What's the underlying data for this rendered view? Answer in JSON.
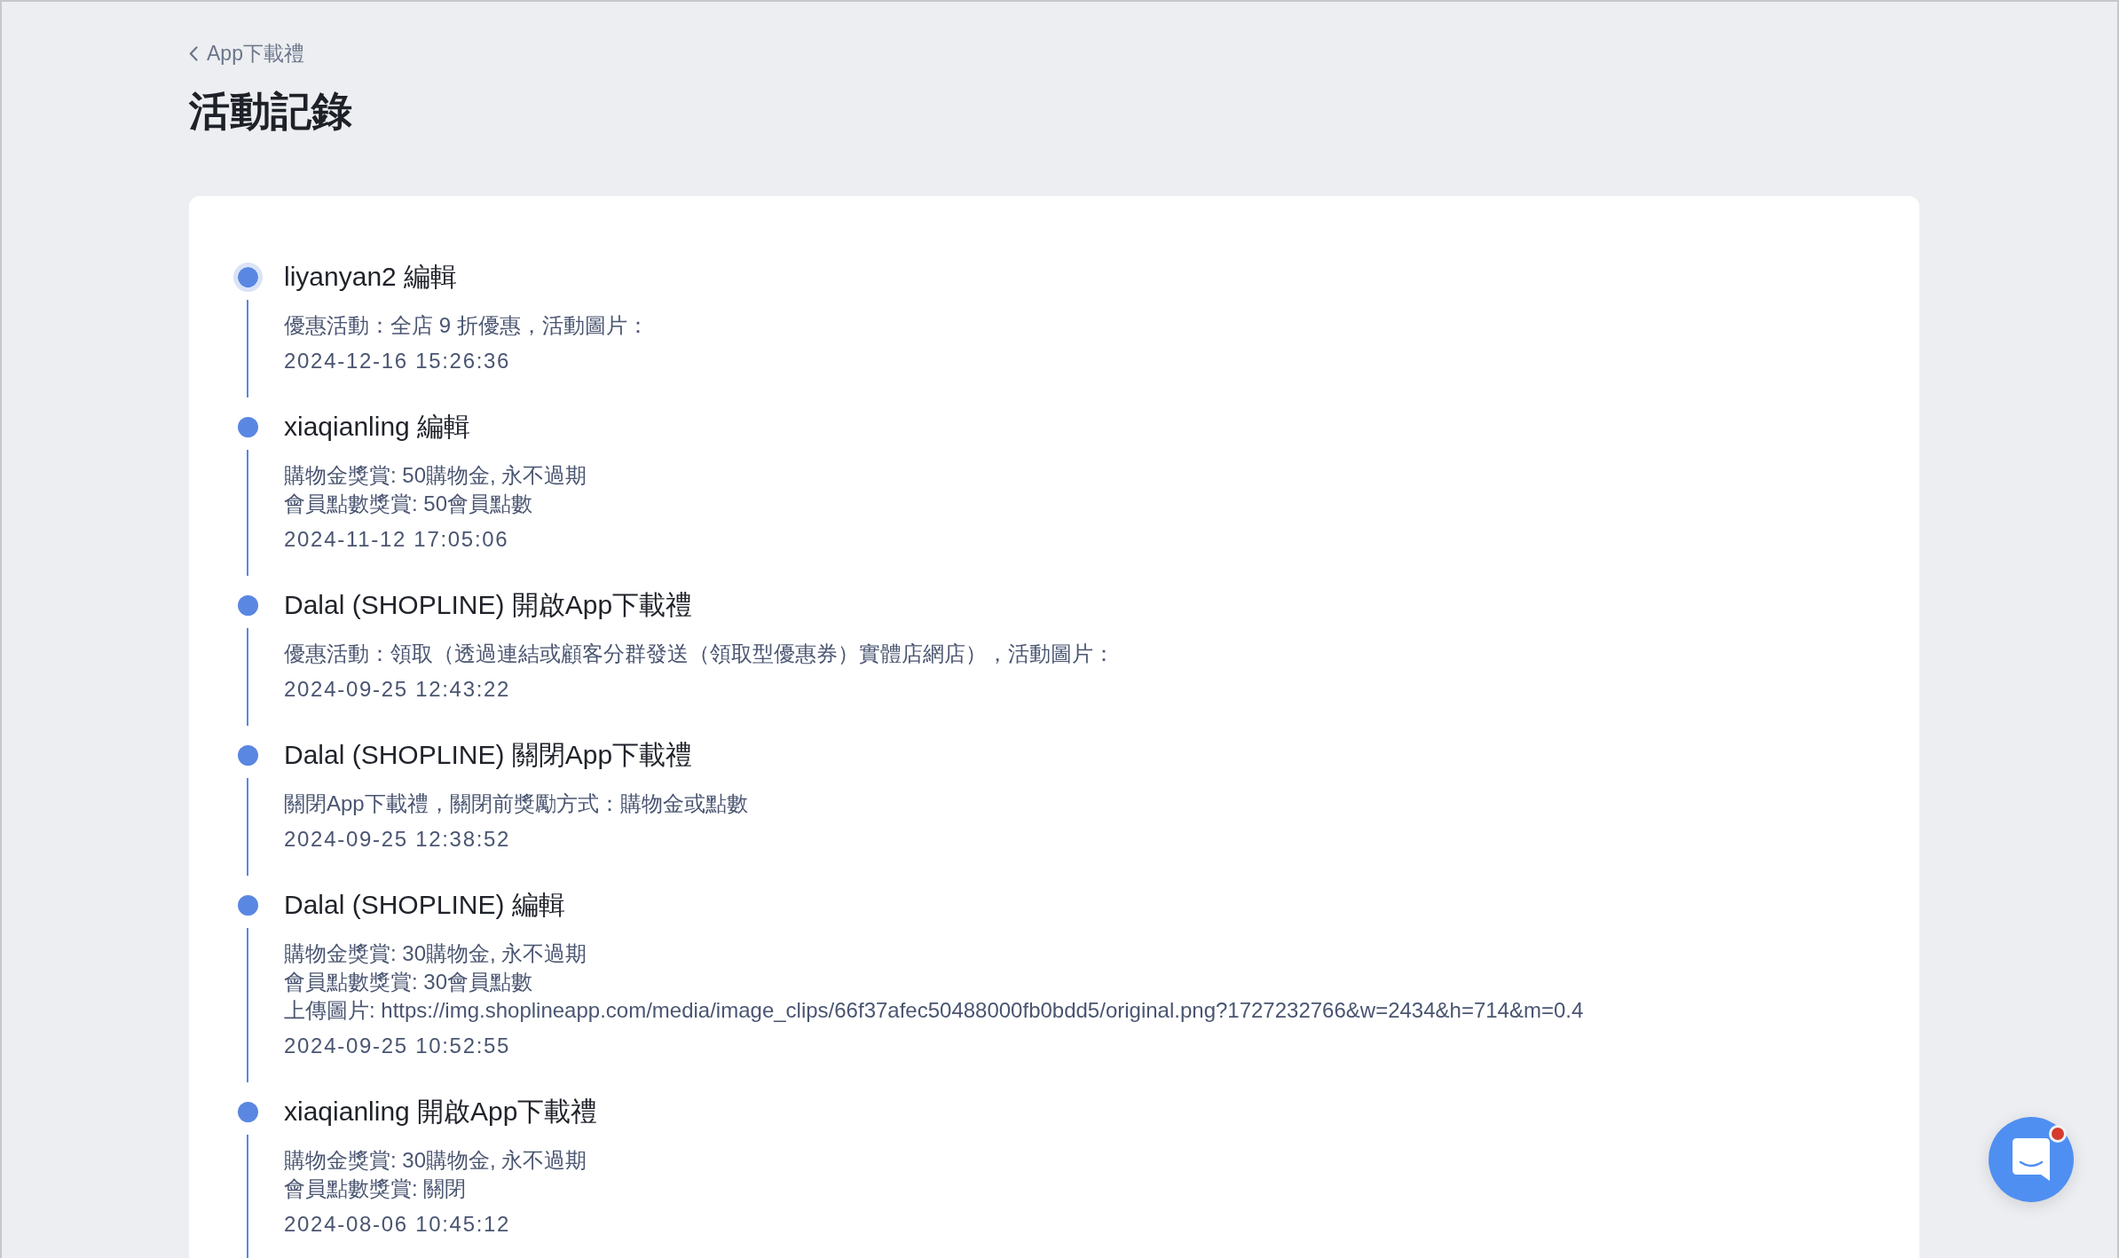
{
  "back_link": {
    "label": "App下載禮"
  },
  "page_title": "活動記錄",
  "activity_log": [
    {
      "title": "liyanyan2 編輯",
      "current": true,
      "details": [
        "優惠活動：全店 9 折優惠，活動圖片："
      ],
      "time": "2024-12-16 15:26:36"
    },
    {
      "title": "xiaqianling 編輯",
      "current": false,
      "details": [
        "購物金獎賞: 50購物金, 永不過期",
        "會員點數獎賞: 50會員點數"
      ],
      "time": "2024-11-12 17:05:06"
    },
    {
      "title": "Dalal (SHOPLINE) 開啟App下載禮",
      "current": false,
      "details": [
        "優惠活動：領取（透過連結或顧客分群發送（領取型優惠券）實體店網店），活動圖片："
      ],
      "time": "2024-09-25 12:43:22"
    },
    {
      "title": "Dalal (SHOPLINE) 關閉App下載禮",
      "current": false,
      "details": [
        "關閉App下載禮，關閉前獎勵方式：購物金或點數"
      ],
      "time": "2024-09-25 12:38:52"
    },
    {
      "title": "Dalal (SHOPLINE) 編輯",
      "current": false,
      "details": [
        "購物金獎賞: 30購物金, 永不過期",
        "會員點數獎賞: 30會員點數",
        "上傳圖片: https://img.shoplineapp.com/media/image_clips/66f37afec50488000fb0bdd5/original.png?1727232766&w=2434&h=714&m=0.4"
      ],
      "time": "2024-09-25 10:52:55"
    },
    {
      "title": "xiaqianling 開啟App下載禮",
      "current": false,
      "details": [
        "購物金獎賞: 30購物金, 永不過期",
        "會員點數獎賞: 關閉"
      ],
      "time": "2024-08-06 10:45:12"
    }
  ],
  "chat_button": {
    "unread": true
  }
}
